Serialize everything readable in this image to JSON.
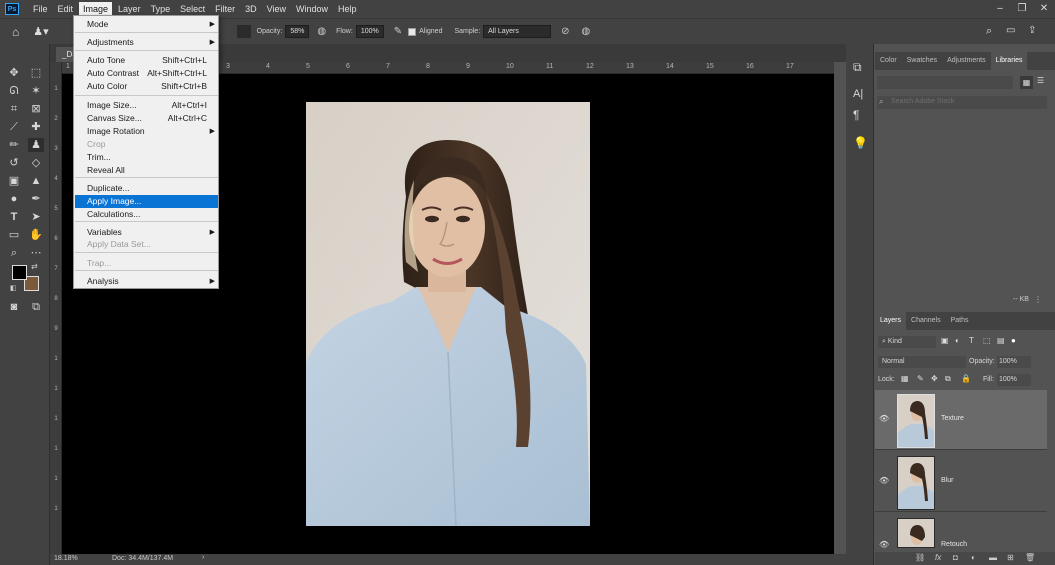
{
  "app": {
    "logo": "Ps"
  },
  "menubar": {
    "items": [
      "File",
      "Edit",
      "Image",
      "Layer",
      "Type",
      "Select",
      "Filter",
      "3D",
      "View",
      "Window",
      "Help"
    ]
  },
  "options": {
    "opacity_label": "Opacity:",
    "opacity_value": "58%",
    "flow_label": "Flow:",
    "flow_value": "100%",
    "aligned_label": "Aligned",
    "sample_label": "Sample:",
    "sample_value": "All Layers"
  },
  "document": {
    "tab_label": "_DSC",
    "ruler_ticks": [
      "1",
      "0",
      "1",
      "2",
      "3",
      "4",
      "5",
      "6",
      "7",
      "8",
      "9",
      "10",
      "11",
      "12",
      "13",
      "14",
      "15",
      "16",
      "17"
    ],
    "vruler_ticks": [
      "1",
      "2",
      "3",
      "4",
      "5",
      "6",
      "7",
      "8",
      "9",
      "1",
      "1",
      "1",
      "1",
      "1",
      "1"
    ],
    "status_zoom": "18.18%",
    "status_doc": "Doc: 34.4M/137.4M",
    "status_arrow": "›"
  },
  "image_menu": {
    "items": [
      {
        "label": "Mode",
        "shortcut": "",
        "submenu": true,
        "disabled": false,
        "highlight": false
      },
      {
        "label": "Adjustments",
        "shortcut": "",
        "submenu": true,
        "disabled": false,
        "highlight": false
      },
      {
        "label": "Auto Tone",
        "shortcut": "Shift+Ctrl+L",
        "submenu": false,
        "disabled": false,
        "highlight": false
      },
      {
        "label": "Auto Contrast",
        "shortcut": "Alt+Shift+Ctrl+L",
        "submenu": false,
        "disabled": false,
        "highlight": false
      },
      {
        "label": "Auto Color",
        "shortcut": "Shift+Ctrl+B",
        "submenu": false,
        "disabled": false,
        "highlight": false
      },
      {
        "label": "Image Size...",
        "shortcut": "Alt+Ctrl+I",
        "submenu": false,
        "disabled": false,
        "highlight": false
      },
      {
        "label": "Canvas Size...",
        "shortcut": "Alt+Ctrl+C",
        "submenu": false,
        "disabled": false,
        "highlight": false
      },
      {
        "label": "Image Rotation",
        "shortcut": "",
        "submenu": true,
        "disabled": false,
        "highlight": false
      },
      {
        "label": "Crop",
        "shortcut": "",
        "submenu": false,
        "disabled": true,
        "highlight": false
      },
      {
        "label": "Trim...",
        "shortcut": "",
        "submenu": false,
        "disabled": false,
        "highlight": false
      },
      {
        "label": "Reveal All",
        "shortcut": "",
        "submenu": false,
        "disabled": false,
        "highlight": false
      },
      {
        "label": "Duplicate...",
        "shortcut": "",
        "submenu": false,
        "disabled": false,
        "highlight": false
      },
      {
        "label": "Apply Image...",
        "shortcut": "",
        "submenu": false,
        "disabled": false,
        "highlight": true
      },
      {
        "label": "Calculations...",
        "shortcut": "",
        "submenu": false,
        "disabled": false,
        "highlight": false
      },
      {
        "label": "Variables",
        "shortcut": "",
        "submenu": true,
        "disabled": false,
        "highlight": false
      },
      {
        "label": "Apply Data Set...",
        "shortcut": "",
        "submenu": false,
        "disabled": true,
        "highlight": false
      },
      {
        "label": "Trap...",
        "shortcut": "",
        "submenu": false,
        "disabled": true,
        "highlight": false
      },
      {
        "label": "Analysis",
        "shortcut": "",
        "submenu": true,
        "disabled": false,
        "highlight": false
      }
    ]
  },
  "library_panel": {
    "tabs": [
      "Color",
      "Swatches",
      "Adjustments",
      "Libraries"
    ],
    "active_tab": "Libraries",
    "search_placeholder": "Search Adobe Stock",
    "size_label": "-- KB"
  },
  "layers_panel": {
    "tabs": [
      "Layers",
      "Channels",
      "Paths"
    ],
    "filter_value": "Kind",
    "blend_mode": "Normal",
    "opacity_label": "Opacity:",
    "opacity_value": "100%",
    "lock_label": "Lock:",
    "fill_label": "Fill:",
    "fill_value": "100%",
    "layers": [
      "Texture",
      "Blur",
      "Retouch"
    ],
    "footer_fx": "fx"
  },
  "colors": {
    "accent": "#31a8ff",
    "highlight": "#0a74d4",
    "foreground": "#000000",
    "background": "#7a5a3a"
  }
}
